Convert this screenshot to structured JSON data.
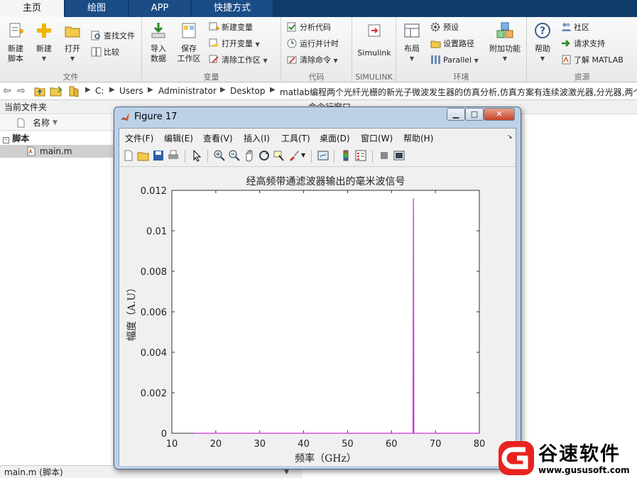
{
  "tabs": [
    {
      "label": "主页",
      "active": true
    },
    {
      "label": "绘图",
      "active": false
    },
    {
      "label": "APP",
      "active": false
    },
    {
      "label": "快捷方式",
      "active": false
    }
  ],
  "ribbon": {
    "file": {
      "label": "文件",
      "new_script": "新建\n脚本",
      "new": "新建",
      "open": "打开",
      "find_files": "查找文件",
      "compare": "比较"
    },
    "variable": {
      "label": "变量",
      "import_data": "导入\n数据",
      "save_workspace": "保存\n工作区",
      "new_variable": "新建变量",
      "open_variable": "打开变量",
      "clear_workspace": "清除工作区"
    },
    "code": {
      "label": "代码",
      "analyze_code": "分析代码",
      "run_and_time": "运行并计时",
      "clear_commands": "清除命令"
    },
    "simulink": {
      "label": "SIMULINK",
      "simulink": "Simulink"
    },
    "environment": {
      "label": "环境",
      "layout": "布局",
      "preferences": "预设",
      "set_path": "设置路径",
      "parallel": "Parallel",
      "addons": "附加功能"
    },
    "resources": {
      "label": "资源",
      "help": "帮助",
      "community": "社区",
      "request_support": "请求支持",
      "learn_matlab": "了解 MATLAB"
    }
  },
  "address": {
    "crumbs": [
      "C:",
      "Users",
      "Administrator",
      "Desktop",
      "matlab编程两个光纤光栅的新光子微波发生器的仿真分析,仿真方案有连续波激光器,分光器,两个"
    ]
  },
  "left_panel": {
    "title": "当前文件夹",
    "col_header": "名称",
    "section": "脚本",
    "files": [
      "main.m"
    ],
    "status": "main.m  (脚本)"
  },
  "command_panel": {
    "title": "命令行窗口"
  },
  "figure": {
    "title": "Figure 17",
    "menus": [
      "文件(F)",
      "编辑(E)",
      "查看(V)",
      "插入(I)",
      "工具(T)",
      "桌面(D)",
      "窗口(W)",
      "帮助(H)"
    ]
  },
  "chart_data": {
    "type": "line",
    "title": "经高频带通滤波器输出的毫米波信号",
    "xlabel": "频率（GHz）",
    "ylabel": "幅度（A.U）",
    "xlim": [
      10,
      80
    ],
    "ylim": [
      0,
      0.012
    ],
    "xticks": [
      10,
      20,
      30,
      40,
      50,
      60,
      70,
      80
    ],
    "xtick_labels": [
      "10",
      "20",
      "30",
      "40",
      "50",
      "60",
      "70",
      "80"
    ],
    "yticks": [
      0,
      0.002,
      0.004,
      0.006,
      0.008,
      0.01,
      0.012
    ],
    "ytick_labels": [
      "0",
      "0.002",
      "0.004",
      "0.006",
      "0.008",
      "0.01",
      "0.012"
    ],
    "grid": false,
    "series": [
      {
        "color": "#cc33dd",
        "x": [
          15,
          64.8,
          64.9,
          65,
          65.1,
          65.2,
          80
        ],
        "y": [
          0,
          0,
          0,
          0.0116,
          0,
          0,
          0
        ]
      }
    ]
  },
  "watermark": {
    "name": "谷速软件",
    "url": "www.gususoft.com"
  },
  "colors": {
    "accent": "#0f3b6b",
    "plot_line": "#cc33dd",
    "watermark_red": "#e8231f"
  }
}
